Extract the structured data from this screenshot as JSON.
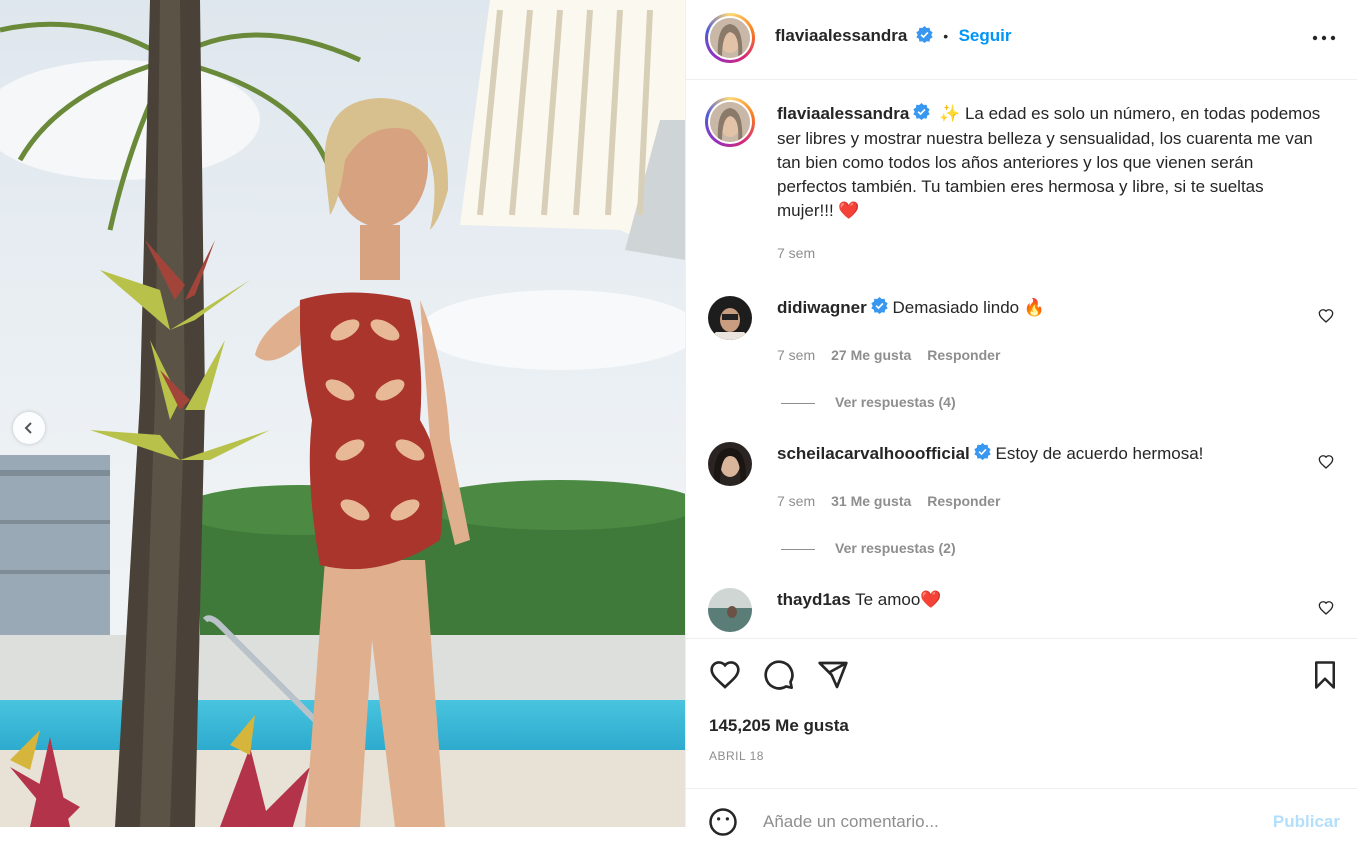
{
  "post": {
    "author": "flaviaalessandra",
    "follow_label": "Seguir",
    "dot": "•",
    "caption_author": "flaviaalessandra",
    "caption_emoji": "✨",
    "caption_text": " La edad es solo un número, en todas podemos ser libres y mostrar nuestra belleza y sensualidad, los cuarenta me van tan bien como todos los años anteriores y los que vienen serán perfectos también. Tu tambien eres hermosa y libre, si te sueltas mujer!!! ",
    "caption_heart": "❤️",
    "caption_time": "7 sem"
  },
  "comments": [
    {
      "user": "didiwagner",
      "text": "Demasiado lindo ",
      "emoji": "🔥",
      "time": "7 sem",
      "likes": "27 Me gusta",
      "reply": "Responder",
      "view_replies": "Ver respuestas (4)"
    },
    {
      "user": "scheilacarvalhooofficial",
      "text": "Estoy de acuerdo hermosa!",
      "emoji": "",
      "time": "7 sem",
      "likes": "31 Me gusta",
      "reply": "Responder",
      "view_replies": "Ver respuestas (2)"
    },
    {
      "user": "thayd1as",
      "text": "Te amoo",
      "emoji": "❤️"
    }
  ],
  "footer": {
    "likes": "145,205 Me gusta",
    "date": "ABRIL 18",
    "comment_placeholder": "Añade un comentario...",
    "publish_label": "Publicar"
  },
  "icons": {
    "like": "heart-icon",
    "comment": "comment-icon",
    "share": "share-icon",
    "save": "bookmark-icon",
    "more": "more-icon",
    "emoji": "emoji-icon",
    "prev": "chevron-left-icon"
  },
  "colors": {
    "accent": "#0095f6",
    "verified": "#3897f0",
    "muted": "#8e8e8e"
  }
}
